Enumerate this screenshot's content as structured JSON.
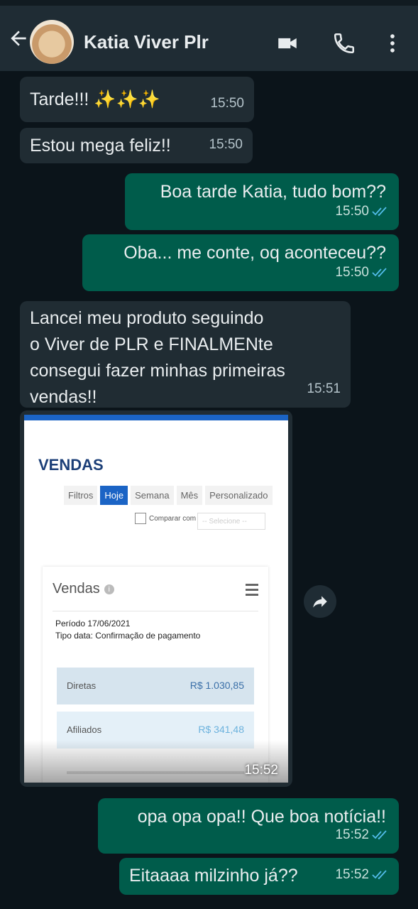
{
  "header": {
    "contact_name": "Katia Viver Plr",
    "icons": [
      "back-arrow-icon",
      "video-call-icon",
      "phone-icon",
      "more-options-icon"
    ]
  },
  "messages": [
    {
      "dir": "in",
      "text": "Tarde!!! ✨✨✨",
      "time": "15:50"
    },
    {
      "dir": "in",
      "text": "Estou mega feliz!!",
      "time": "15:50"
    },
    {
      "dir": "out",
      "text": "Boa tarde Katia, tudo bom??",
      "time": "15:50"
    },
    {
      "dir": "out",
      "text": "Oba... me conte, oq aconteceu??",
      "time": "15:50"
    },
    {
      "dir": "in",
      "text": "Lancei meu produto seguindo\no Viver de PLR e FINALMENte\nconsegui fazer minhas primeiras\nvendas!!",
      "time": "15:51"
    },
    {
      "dir": "out",
      "text": "opa opa opa!! Que boa notícia!!",
      "time": "15:52"
    },
    {
      "dir": "out",
      "text": "Eitaaaa milzinho já??",
      "time": "15:52"
    }
  ],
  "image_message": {
    "time": "15:52",
    "screenshot": {
      "title": "VENDAS",
      "filters": [
        "Filtros",
        "Hoje",
        "Semana",
        "Mês",
        "Personalizado"
      ],
      "active_filter": "Hoje",
      "compare_label": "Comparar com",
      "select_placeholder": "-- Selecione --",
      "panel_title": "Vendas",
      "period": "Período 17/06/2021",
      "date_type": "Tipo data: Confirmação de pagamento",
      "rows": [
        {
          "label": "Diretas",
          "value": "R$ 1.030,85"
        },
        {
          "label": "Afiliados",
          "value": "R$ 341,48"
        }
      ]
    }
  },
  "colors": {
    "incoming_bubble": "#202c33",
    "outgoing_bubble": "#005c4b",
    "read_tick": "#53bdeb",
    "header": "#1f2c34"
  }
}
